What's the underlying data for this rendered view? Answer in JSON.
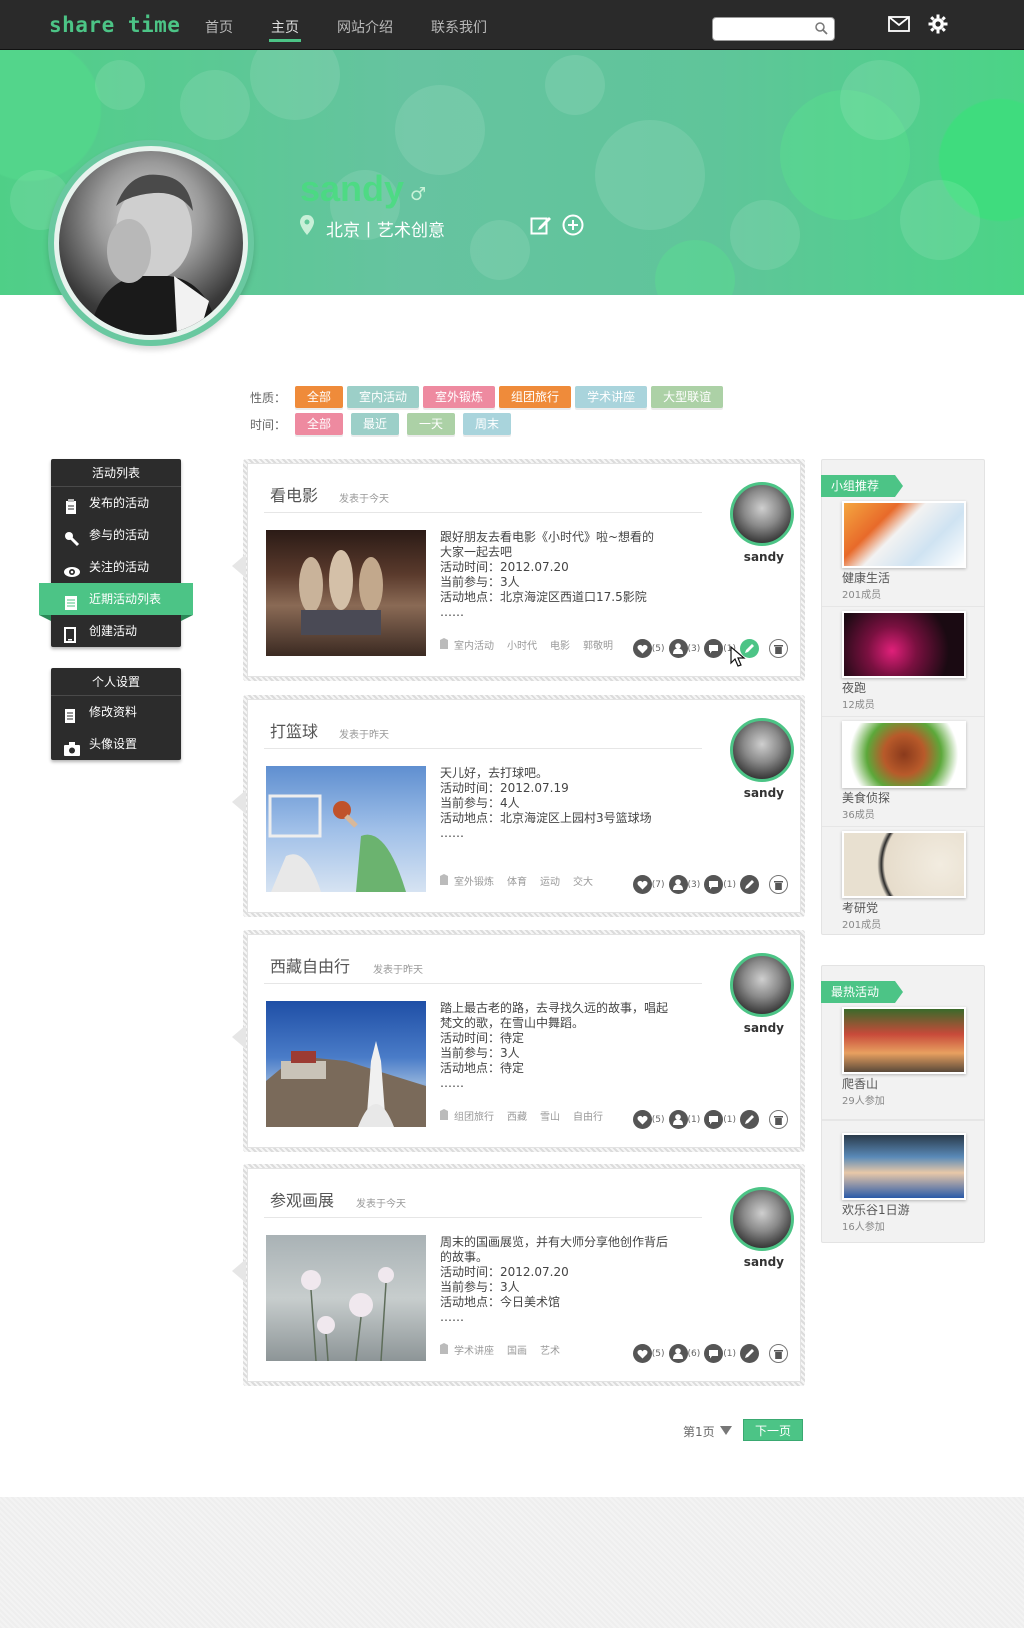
{
  "header": {
    "logo": "share time",
    "nav": [
      "首页",
      "主页",
      "网站介绍",
      "联系我们"
    ],
    "active_nav": 1,
    "search_placeholder": ""
  },
  "profile": {
    "name": "sandy",
    "gender_symbol": "♂",
    "location": "北京丨艺术创意"
  },
  "filters": {
    "type_label": "性质：",
    "types": [
      {
        "label": "全部",
        "color": "#ef8b3a"
      },
      {
        "label": "室内活动",
        "color": "#9ccfc8"
      },
      {
        "label": "室外锻炼",
        "color": "#ee8aa0"
      },
      {
        "label": "组团旅行",
        "color": "#ef8b3a"
      },
      {
        "label": "学术讲座",
        "color": "#a9d4dc"
      },
      {
        "label": "大型联谊",
        "color": "#acd1a6"
      }
    ],
    "time_label": "时间：",
    "times": [
      {
        "label": "全部",
        "color": "#ee8aa0"
      },
      {
        "label": "最近",
        "color": "#9ccfc8"
      },
      {
        "label": "一天",
        "color": "#acd1a6"
      },
      {
        "label": "周末",
        "color": "#a9d4dc"
      }
    ]
  },
  "menu1": {
    "title": "活动列表",
    "items": [
      "发布的活动",
      "参与的活动",
      "关注的活动",
      "近期活动列表",
      "创建活动"
    ],
    "active": 3
  },
  "menu2": {
    "title": "个人设置",
    "items": [
      "修改资料",
      "头像设置"
    ]
  },
  "cards": [
    {
      "title": "看电影",
      "time": "发表于今天",
      "author": "sandy",
      "lines": [
        "跟好朋友去看电影《小时代》啦~想看的",
        "大家一起去吧",
        "活动时间：2012.07.20",
        "当前参与：3人",
        "活动地点：北京海淀区西道口17.5影院",
        "……"
      ],
      "tags": [
        "室内活动",
        "小时代",
        "电影",
        "郭敬明"
      ],
      "likes": "(5)",
      "joins": "(3)",
      "comments": "(1)"
    },
    {
      "title": "打篮球",
      "time": "发表于昨天",
      "author": "sandy",
      "lines": [
        "天儿好，去打球吧。",
        "活动时间：2012.07.19",
        "当前参与：4人",
        "活动地点：北京海淀区上园村3号篮球场",
        "……"
      ],
      "tags": [
        "室外锻炼",
        "体育",
        "运动",
        "交大"
      ],
      "likes": "(7)",
      "joins": "(3)",
      "comments": "(1)"
    },
    {
      "title": "西藏自由行",
      "time": "发表于昨天",
      "author": "sandy",
      "lines": [
        "踏上最古老的路，去寻找久远的故事，唱起",
        "梵文的歌，在雪山中舞蹈。",
        "活动时间：待定",
        "当前参与：3人",
        "活动地点：待定",
        "……"
      ],
      "tags": [
        "组团旅行",
        "西藏",
        "雪山",
        "自由行"
      ],
      "likes": "(5)",
      "joins": "(1)",
      "comments": "(1)"
    },
    {
      "title": "参观画展",
      "time": "发表于今天",
      "author": "sandy",
      "lines": [
        "周末的国画展览，并有大师分享他创作背后",
        "的故事。",
        "活动时间：2012.07.20",
        "当前参与：3人",
        "活动地点：今日美术馆",
        "……"
      ],
      "tags": [
        "学术讲座",
        "国画",
        "艺术"
      ],
      "likes": "(5)",
      "joins": "(6)",
      "comments": "(1)"
    }
  ],
  "recommend": {
    "title": "小组推荐",
    "groups": [
      {
        "name": "健康生活",
        "sub": "201成员"
      },
      {
        "name": "夜跑",
        "sub": "12成员"
      },
      {
        "name": "美食侦探",
        "sub": "36成员"
      },
      {
        "name": "考研党",
        "sub": "201成员"
      }
    ]
  },
  "hot": {
    "title": "最热活动",
    "groups": [
      {
        "name": "爬香山",
        "sub": "29人参加"
      },
      {
        "name": "欢乐谷1日游",
        "sub": "16人参加"
      }
    ]
  },
  "pager": {
    "page": "第1页",
    "next": "下一页"
  },
  "colors": {
    "accent": "#4cc486",
    "nav_bg": "#2a2a2a"
  }
}
